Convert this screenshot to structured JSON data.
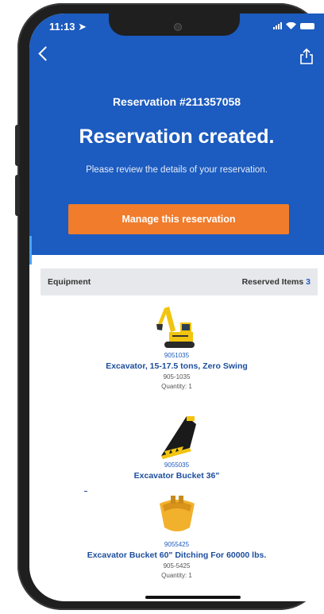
{
  "status_bar": {
    "time": "11:13"
  },
  "nav": {
    "back_icon": "chevron-left-icon",
    "share_icon": "share-icon"
  },
  "reservation": {
    "number_label": "Reservation #211357058",
    "headline": "Reservation created.",
    "subtext": "Please review the details of your reservation.",
    "manage_button": "Manage this reservation"
  },
  "equipment": {
    "header_label": "Equipment",
    "reserved_label": "Reserved Items",
    "reserved_count": "3",
    "items": [
      {
        "sku": "9051035",
        "name": "Excavator, 15-17.5 tons, Zero Swing",
        "part": "905-1035",
        "quantity": "Quantity: 1",
        "image": "excavator"
      },
      {
        "sku": "9055035",
        "name": "Excavator Bucket 36\"",
        "image": "bucket-teeth"
      },
      {
        "sku": "9055425",
        "name": "Excavator Bucket 60\" Ditching For 60000 lbs.",
        "part": "905-5425",
        "quantity": "Quantity: 1",
        "image": "ditching-bucket"
      }
    ]
  },
  "colors": {
    "primary": "#1c5bbf",
    "accent": "#f07c2c",
    "header_bg": "#e7e8ec"
  }
}
